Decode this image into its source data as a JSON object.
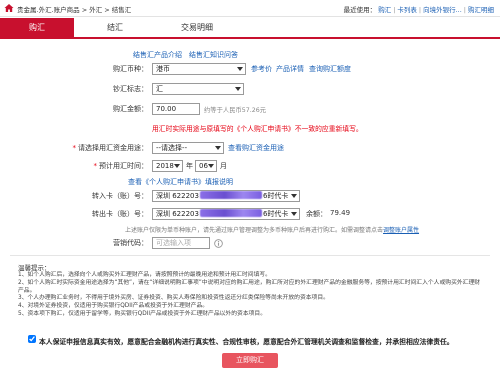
{
  "breadcrumb": "贵金属.外汇.账户商品 > 外汇 > 结售汇",
  "recent": {
    "label": "最近使用：",
    "separator": "|",
    "items": [
      "购汇",
      "卡列表",
      "向境外银行...",
      "购汇明细"
    ]
  },
  "tabs": [
    {
      "label": "购汇",
      "active": true
    },
    {
      "label": "结汇",
      "active": false
    },
    {
      "label": "交易明细",
      "active": false
    }
  ],
  "intro_links": [
    "结售汇产品介绍",
    "结售汇知识问答"
  ],
  "form": {
    "currency": {
      "label": "购汇币种：",
      "value": "港币",
      "links": [
        "参考价",
        "产品详情",
        "查询购汇额度"
      ]
    },
    "cash_flag": {
      "label": "钞汇标志：",
      "value": "汇"
    },
    "amount": {
      "label": "购汇金额：",
      "value": "70.00",
      "note": "约等于人民币57.26元"
    },
    "warning": "用汇时实际用途与原填写的《个人购汇申请书》不一致的应重新填写。",
    "purpose": {
      "required": "*",
      "label": "请选择用汇资金用途：",
      "value": "--请选择--",
      "link": "查看购汇资金用途"
    },
    "expected_time": {
      "required": "*",
      "label": "预计用汇时间：",
      "year": "2018",
      "year_unit": "年",
      "month": "06",
      "month_unit": "月"
    },
    "application_link": "查看《个人购汇申请书》填报说明",
    "in_card": {
      "label": "转入卡（账）号：",
      "prefix": "深圳 622203",
      "suffix": "6时代卡"
    },
    "out_card": {
      "label": "转出卡（账）号：",
      "prefix": "深圳 622203",
      "suffix": "6时代卡",
      "balance_label": "余额：",
      "balance": "79.49"
    },
    "account_note": {
      "text": "上述账户仅限为单币种账户，请先通过账户管理调整为多币种账户后再进行购汇。如需调整请点击",
      "link": "调整账户属性"
    },
    "marketing_code": {
      "label": "营销代码：",
      "placeholder": "可选输入项"
    }
  },
  "tips": {
    "heading": "温馨提示：",
    "lines": [
      "1、如个人购汇后，选择向个人或购买外汇理财产品，请按照预计的最晚用途和预计用汇时间填写。",
      "2、如个人购汇时实际资金用途选择为“其他”，请在“详细说明购汇事项”中说明对应的购汇用途，购汇所对应的外汇理财产品的金融服务等，按预计用汇时间汇入个人或购买外汇理财产品。",
      "3、个人办理购汇业务时，不得用于境外买房、证券投资、购买人寿保险和投资性返还分红类保险等尚未开放的资本项目。",
      "4、对境外证券投资，仅适用于购买银行QDII产品或投资于外汇理财产品。",
      "5、资本项下购汇，仅适用于留学等，购买银行QDII产品或投资于外汇理财产品以外的资本项目。"
    ]
  },
  "agreement": {
    "checked": true,
    "text": "本人保证申报信息真实有效，愿意配合金融机构进行真实性、合规性审核，愿意配合外汇管理机关调查和监督检查，并承担相应法律责任。"
  },
  "submit_label": "立即购汇",
  "icons": {
    "home": "home-icon",
    "dropdown": "chevron-down-icon",
    "info": "info-icon"
  },
  "colors": {
    "accent": "#c8102e",
    "link": "#1a5fb4",
    "warning": "#e60012",
    "button": "#e8555f",
    "mask": "#7b5cd6"
  }
}
